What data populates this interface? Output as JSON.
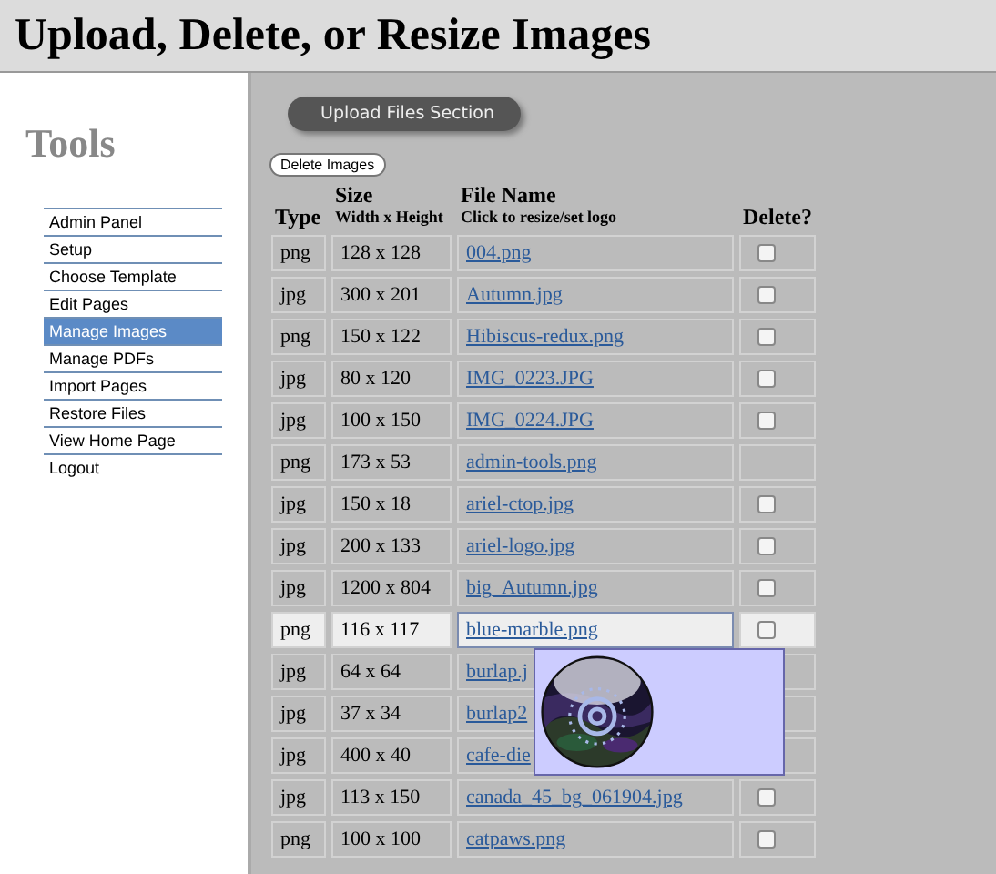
{
  "header": {
    "title": "Upload, Delete, or Resize Images"
  },
  "sidebar": {
    "title": "Tools",
    "items": [
      {
        "label": "Admin Panel",
        "selected": false
      },
      {
        "label": "Setup",
        "selected": false
      },
      {
        "label": "Choose Template",
        "selected": false
      },
      {
        "label": "Edit Pages",
        "selected": false
      },
      {
        "label": "Manage Images",
        "selected": true
      },
      {
        "label": "Manage PDFs",
        "selected": false
      },
      {
        "label": "Import Pages",
        "selected": false
      },
      {
        "label": "Restore Files",
        "selected": false
      },
      {
        "label": "View Home Page",
        "selected": false
      },
      {
        "label": "Logout",
        "selected": false
      }
    ]
  },
  "upload_button": "Upload Files Section",
  "delete_button": "Delete Images",
  "table": {
    "columns": [
      {
        "title": "Type"
      },
      {
        "title": "Size",
        "subtitle": "Width x Height"
      },
      {
        "title": "File Name",
        "subtitle": "Click to resize/set logo"
      },
      {
        "title": "Delete?"
      }
    ],
    "rows": [
      {
        "type": "png",
        "size": "128 x 128",
        "file": "004.png",
        "selected": false,
        "checked": false
      },
      {
        "type": "jpg",
        "size": "300 x 201",
        "file": "Autumn.jpg",
        "selected": false,
        "checked": false
      },
      {
        "type": "png",
        "size": "150 x 122",
        "file": "Hibiscus-redux.png",
        "selected": false,
        "checked": false
      },
      {
        "type": "jpg",
        "size": "80 x 120",
        "file": "IMG_0223.JPG",
        "selected": false,
        "checked": false
      },
      {
        "type": "jpg",
        "size": "100 x 150",
        "file": "IMG_0224.JPG",
        "selected": false,
        "checked": false
      },
      {
        "type": "png",
        "size": "173 x 53",
        "file": "admin-tools.png",
        "selected": false
      },
      {
        "type": "jpg",
        "size": "150 x 18",
        "file": "ariel-ctop.jpg",
        "selected": false,
        "checked": false
      },
      {
        "type": "jpg",
        "size": "200 x 133",
        "file": "ariel-logo.jpg",
        "selected": false,
        "checked": false
      },
      {
        "type": "jpg",
        "size": "1200 x 804",
        "file": "big_Autumn.jpg",
        "selected": false,
        "checked": false
      },
      {
        "type": "png",
        "size": "116 x 117",
        "file": "blue-marble.png",
        "selected": true,
        "checked": false
      },
      {
        "type": "jpg",
        "size": "64 x 64",
        "file": "burlap.j",
        "selected": false
      },
      {
        "type": "jpg",
        "size": "37 x 34",
        "file": "burlap2",
        "selected": false
      },
      {
        "type": "jpg",
        "size": "400 x 40",
        "file": "cafe-die",
        "selected": false
      },
      {
        "type": "jpg",
        "size": "113 x 150",
        "file": "canada_45_bg_061904.jpg",
        "selected": false,
        "checked": false
      },
      {
        "type": "png",
        "size": "100 x 100",
        "file": "catpaws.png",
        "selected": false,
        "checked": false
      }
    ]
  }
}
